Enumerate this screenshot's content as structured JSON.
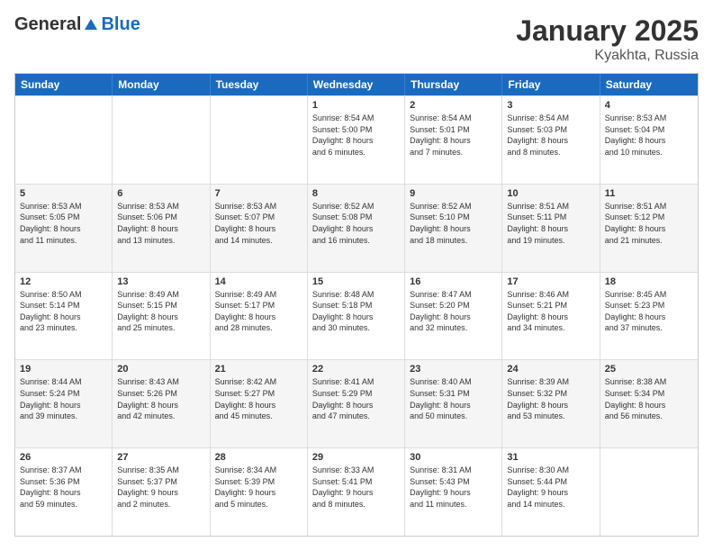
{
  "logo": {
    "general": "General",
    "blue": "Blue"
  },
  "title": "January 2025",
  "subtitle": "Kyakhta, Russia",
  "days": [
    "Sunday",
    "Monday",
    "Tuesday",
    "Wednesday",
    "Thursday",
    "Friday",
    "Saturday"
  ],
  "weeks": [
    [
      {
        "day": "",
        "info": ""
      },
      {
        "day": "",
        "info": ""
      },
      {
        "day": "",
        "info": ""
      },
      {
        "day": "1",
        "info": "Sunrise: 8:54 AM\nSunset: 5:00 PM\nDaylight: 8 hours\nand 6 minutes."
      },
      {
        "day": "2",
        "info": "Sunrise: 8:54 AM\nSunset: 5:01 PM\nDaylight: 8 hours\nand 7 minutes."
      },
      {
        "day": "3",
        "info": "Sunrise: 8:54 AM\nSunset: 5:03 PM\nDaylight: 8 hours\nand 8 minutes."
      },
      {
        "day": "4",
        "info": "Sunrise: 8:53 AM\nSunset: 5:04 PM\nDaylight: 8 hours\nand 10 minutes."
      }
    ],
    [
      {
        "day": "5",
        "info": "Sunrise: 8:53 AM\nSunset: 5:05 PM\nDaylight: 8 hours\nand 11 minutes."
      },
      {
        "day": "6",
        "info": "Sunrise: 8:53 AM\nSunset: 5:06 PM\nDaylight: 8 hours\nand 13 minutes."
      },
      {
        "day": "7",
        "info": "Sunrise: 8:53 AM\nSunset: 5:07 PM\nDaylight: 8 hours\nand 14 minutes."
      },
      {
        "day": "8",
        "info": "Sunrise: 8:52 AM\nSunset: 5:08 PM\nDaylight: 8 hours\nand 16 minutes."
      },
      {
        "day": "9",
        "info": "Sunrise: 8:52 AM\nSunset: 5:10 PM\nDaylight: 8 hours\nand 18 minutes."
      },
      {
        "day": "10",
        "info": "Sunrise: 8:51 AM\nSunset: 5:11 PM\nDaylight: 8 hours\nand 19 minutes."
      },
      {
        "day": "11",
        "info": "Sunrise: 8:51 AM\nSunset: 5:12 PM\nDaylight: 8 hours\nand 21 minutes."
      }
    ],
    [
      {
        "day": "12",
        "info": "Sunrise: 8:50 AM\nSunset: 5:14 PM\nDaylight: 8 hours\nand 23 minutes."
      },
      {
        "day": "13",
        "info": "Sunrise: 8:49 AM\nSunset: 5:15 PM\nDaylight: 8 hours\nand 25 minutes."
      },
      {
        "day": "14",
        "info": "Sunrise: 8:49 AM\nSunset: 5:17 PM\nDaylight: 8 hours\nand 28 minutes."
      },
      {
        "day": "15",
        "info": "Sunrise: 8:48 AM\nSunset: 5:18 PM\nDaylight: 8 hours\nand 30 minutes."
      },
      {
        "day": "16",
        "info": "Sunrise: 8:47 AM\nSunset: 5:20 PM\nDaylight: 8 hours\nand 32 minutes."
      },
      {
        "day": "17",
        "info": "Sunrise: 8:46 AM\nSunset: 5:21 PM\nDaylight: 8 hours\nand 34 minutes."
      },
      {
        "day": "18",
        "info": "Sunrise: 8:45 AM\nSunset: 5:23 PM\nDaylight: 8 hours\nand 37 minutes."
      }
    ],
    [
      {
        "day": "19",
        "info": "Sunrise: 8:44 AM\nSunset: 5:24 PM\nDaylight: 8 hours\nand 39 minutes."
      },
      {
        "day": "20",
        "info": "Sunrise: 8:43 AM\nSunset: 5:26 PM\nDaylight: 8 hours\nand 42 minutes."
      },
      {
        "day": "21",
        "info": "Sunrise: 8:42 AM\nSunset: 5:27 PM\nDaylight: 8 hours\nand 45 minutes."
      },
      {
        "day": "22",
        "info": "Sunrise: 8:41 AM\nSunset: 5:29 PM\nDaylight: 8 hours\nand 47 minutes."
      },
      {
        "day": "23",
        "info": "Sunrise: 8:40 AM\nSunset: 5:31 PM\nDaylight: 8 hours\nand 50 minutes."
      },
      {
        "day": "24",
        "info": "Sunrise: 8:39 AM\nSunset: 5:32 PM\nDaylight: 8 hours\nand 53 minutes."
      },
      {
        "day": "25",
        "info": "Sunrise: 8:38 AM\nSunset: 5:34 PM\nDaylight: 8 hours\nand 56 minutes."
      }
    ],
    [
      {
        "day": "26",
        "info": "Sunrise: 8:37 AM\nSunset: 5:36 PM\nDaylight: 8 hours\nand 59 minutes."
      },
      {
        "day": "27",
        "info": "Sunrise: 8:35 AM\nSunset: 5:37 PM\nDaylight: 9 hours\nand 2 minutes."
      },
      {
        "day": "28",
        "info": "Sunrise: 8:34 AM\nSunset: 5:39 PM\nDaylight: 9 hours\nand 5 minutes."
      },
      {
        "day": "29",
        "info": "Sunrise: 8:33 AM\nSunset: 5:41 PM\nDaylight: 9 hours\nand 8 minutes."
      },
      {
        "day": "30",
        "info": "Sunrise: 8:31 AM\nSunset: 5:43 PM\nDaylight: 9 hours\nand 11 minutes."
      },
      {
        "day": "31",
        "info": "Sunrise: 8:30 AM\nSunset: 5:44 PM\nDaylight: 9 hours\nand 14 minutes."
      },
      {
        "day": "",
        "info": ""
      }
    ]
  ]
}
